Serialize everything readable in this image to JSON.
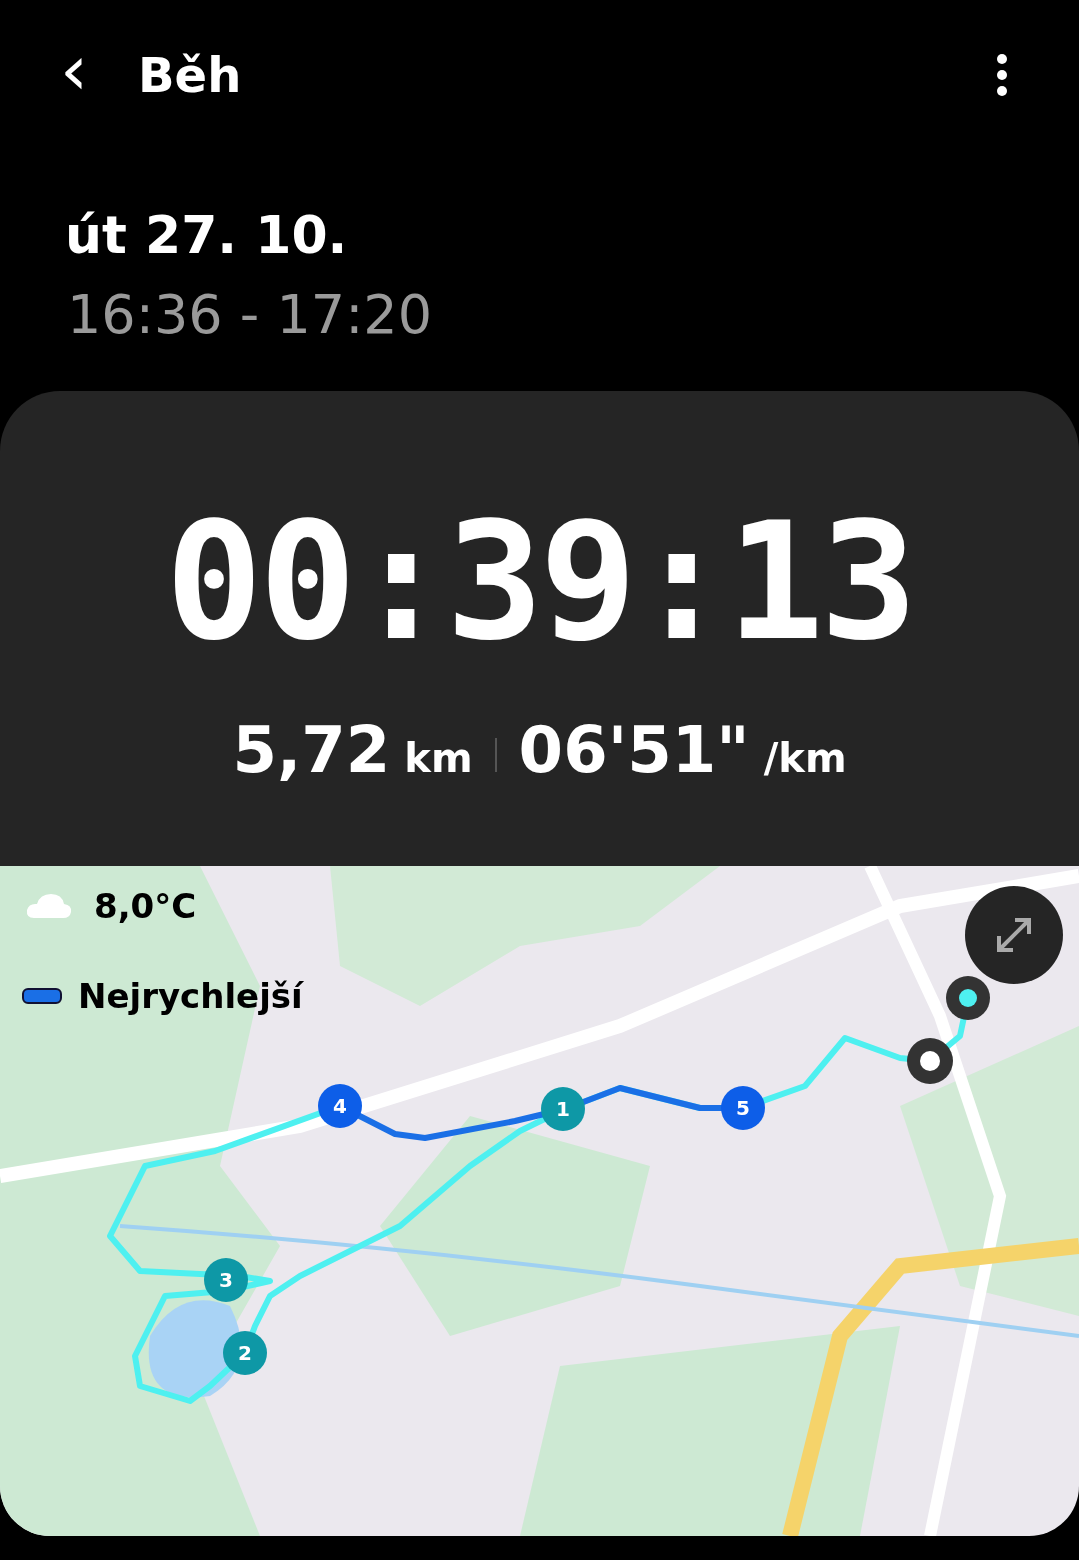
{
  "header": {
    "back": "‹",
    "title": "Běh"
  },
  "date": "út 27. 10.",
  "time_range": "16:36 - 17:20",
  "summary": {
    "duration": "00:39:13",
    "distance": "5,72",
    "distance_unit": "km",
    "pace": "06'51\"",
    "pace_unit": "/km"
  },
  "map": {
    "kind": "picture",
    "temperature": "8,0°C",
    "legend": "Nejrychlejší",
    "markers": [
      {
        "label": "4",
        "color": "#0d5ee8"
      },
      {
        "label": "1",
        "color": "#0e98a6"
      },
      {
        "label": "5",
        "color": "#0d5ee8"
      },
      {
        "label": "3",
        "color": "#0e98a6"
      },
      {
        "label": "2",
        "color": "#0e98a6"
      }
    ]
  }
}
